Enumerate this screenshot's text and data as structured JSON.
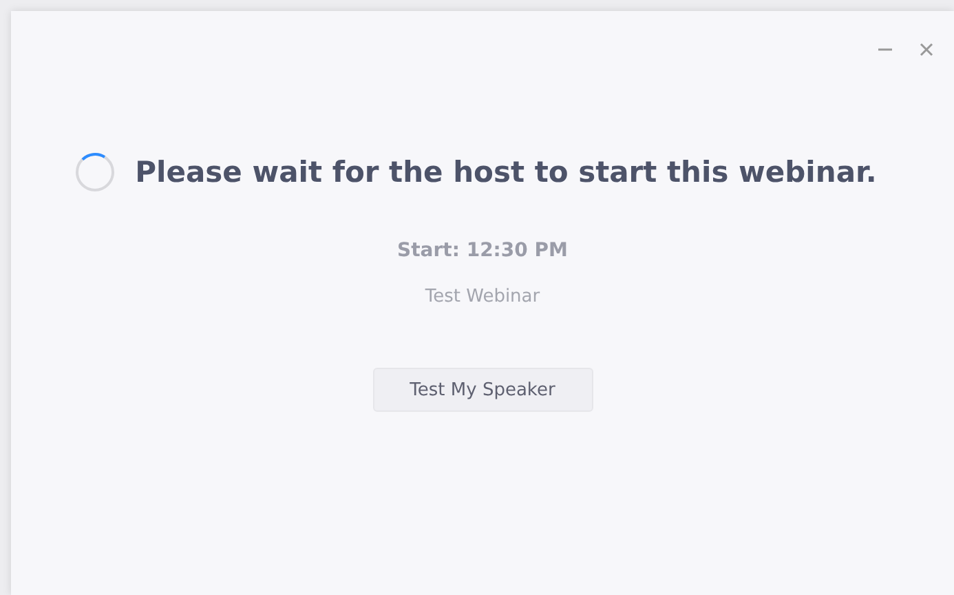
{
  "message": "Please wait for the host to start this webinar.",
  "start": "Start: 12:30 PM",
  "topic": "Test Webinar",
  "buttons": [
    "Test My Speaker"
  ]
}
